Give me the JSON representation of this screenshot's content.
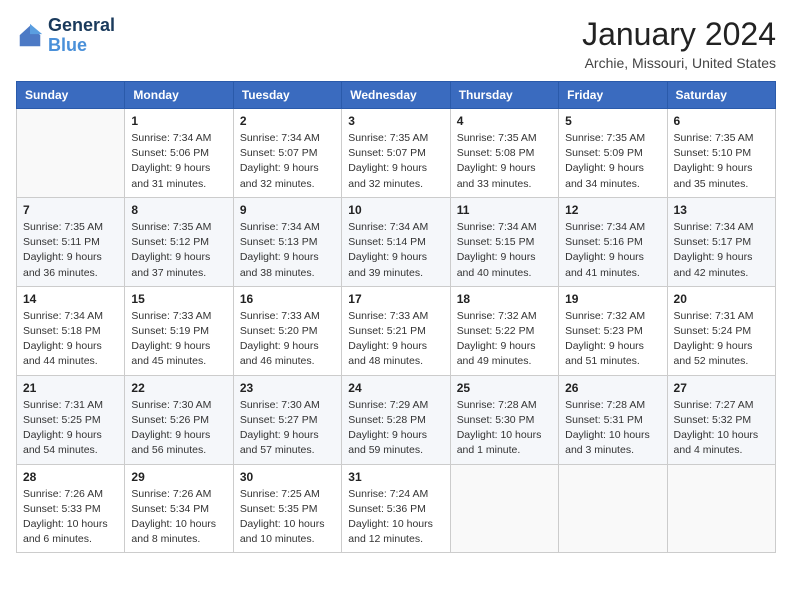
{
  "header": {
    "logo_line1": "General",
    "logo_line2": "Blue",
    "month_title": "January 2024",
    "location": "Archie, Missouri, United States"
  },
  "weekdays": [
    "Sunday",
    "Monday",
    "Tuesday",
    "Wednesday",
    "Thursday",
    "Friday",
    "Saturday"
  ],
  "weeks": [
    [
      {
        "day": "",
        "sunrise": "",
        "sunset": "",
        "daylight": ""
      },
      {
        "day": "1",
        "sunrise": "Sunrise: 7:34 AM",
        "sunset": "Sunset: 5:06 PM",
        "daylight": "Daylight: 9 hours and 31 minutes."
      },
      {
        "day": "2",
        "sunrise": "Sunrise: 7:34 AM",
        "sunset": "Sunset: 5:07 PM",
        "daylight": "Daylight: 9 hours and 32 minutes."
      },
      {
        "day": "3",
        "sunrise": "Sunrise: 7:35 AM",
        "sunset": "Sunset: 5:07 PM",
        "daylight": "Daylight: 9 hours and 32 minutes."
      },
      {
        "day": "4",
        "sunrise": "Sunrise: 7:35 AM",
        "sunset": "Sunset: 5:08 PM",
        "daylight": "Daylight: 9 hours and 33 minutes."
      },
      {
        "day": "5",
        "sunrise": "Sunrise: 7:35 AM",
        "sunset": "Sunset: 5:09 PM",
        "daylight": "Daylight: 9 hours and 34 minutes."
      },
      {
        "day": "6",
        "sunrise": "Sunrise: 7:35 AM",
        "sunset": "Sunset: 5:10 PM",
        "daylight": "Daylight: 9 hours and 35 minutes."
      }
    ],
    [
      {
        "day": "7",
        "sunrise": "Sunrise: 7:35 AM",
        "sunset": "Sunset: 5:11 PM",
        "daylight": "Daylight: 9 hours and 36 minutes."
      },
      {
        "day": "8",
        "sunrise": "Sunrise: 7:35 AM",
        "sunset": "Sunset: 5:12 PM",
        "daylight": "Daylight: 9 hours and 37 minutes."
      },
      {
        "day": "9",
        "sunrise": "Sunrise: 7:34 AM",
        "sunset": "Sunset: 5:13 PM",
        "daylight": "Daylight: 9 hours and 38 minutes."
      },
      {
        "day": "10",
        "sunrise": "Sunrise: 7:34 AM",
        "sunset": "Sunset: 5:14 PM",
        "daylight": "Daylight: 9 hours and 39 minutes."
      },
      {
        "day": "11",
        "sunrise": "Sunrise: 7:34 AM",
        "sunset": "Sunset: 5:15 PM",
        "daylight": "Daylight: 9 hours and 40 minutes."
      },
      {
        "day": "12",
        "sunrise": "Sunrise: 7:34 AM",
        "sunset": "Sunset: 5:16 PM",
        "daylight": "Daylight: 9 hours and 41 minutes."
      },
      {
        "day": "13",
        "sunrise": "Sunrise: 7:34 AM",
        "sunset": "Sunset: 5:17 PM",
        "daylight": "Daylight: 9 hours and 42 minutes."
      }
    ],
    [
      {
        "day": "14",
        "sunrise": "Sunrise: 7:34 AM",
        "sunset": "Sunset: 5:18 PM",
        "daylight": "Daylight: 9 hours and 44 minutes."
      },
      {
        "day": "15",
        "sunrise": "Sunrise: 7:33 AM",
        "sunset": "Sunset: 5:19 PM",
        "daylight": "Daylight: 9 hours and 45 minutes."
      },
      {
        "day": "16",
        "sunrise": "Sunrise: 7:33 AM",
        "sunset": "Sunset: 5:20 PM",
        "daylight": "Daylight: 9 hours and 46 minutes."
      },
      {
        "day": "17",
        "sunrise": "Sunrise: 7:33 AM",
        "sunset": "Sunset: 5:21 PM",
        "daylight": "Daylight: 9 hours and 48 minutes."
      },
      {
        "day": "18",
        "sunrise": "Sunrise: 7:32 AM",
        "sunset": "Sunset: 5:22 PM",
        "daylight": "Daylight: 9 hours and 49 minutes."
      },
      {
        "day": "19",
        "sunrise": "Sunrise: 7:32 AM",
        "sunset": "Sunset: 5:23 PM",
        "daylight": "Daylight: 9 hours and 51 minutes."
      },
      {
        "day": "20",
        "sunrise": "Sunrise: 7:31 AM",
        "sunset": "Sunset: 5:24 PM",
        "daylight": "Daylight: 9 hours and 52 minutes."
      }
    ],
    [
      {
        "day": "21",
        "sunrise": "Sunrise: 7:31 AM",
        "sunset": "Sunset: 5:25 PM",
        "daylight": "Daylight: 9 hours and 54 minutes."
      },
      {
        "day": "22",
        "sunrise": "Sunrise: 7:30 AM",
        "sunset": "Sunset: 5:26 PM",
        "daylight": "Daylight: 9 hours and 56 minutes."
      },
      {
        "day": "23",
        "sunrise": "Sunrise: 7:30 AM",
        "sunset": "Sunset: 5:27 PM",
        "daylight": "Daylight: 9 hours and 57 minutes."
      },
      {
        "day": "24",
        "sunrise": "Sunrise: 7:29 AM",
        "sunset": "Sunset: 5:28 PM",
        "daylight": "Daylight: 9 hours and 59 minutes."
      },
      {
        "day": "25",
        "sunrise": "Sunrise: 7:28 AM",
        "sunset": "Sunset: 5:30 PM",
        "daylight": "Daylight: 10 hours and 1 minute."
      },
      {
        "day": "26",
        "sunrise": "Sunrise: 7:28 AM",
        "sunset": "Sunset: 5:31 PM",
        "daylight": "Daylight: 10 hours and 3 minutes."
      },
      {
        "day": "27",
        "sunrise": "Sunrise: 7:27 AM",
        "sunset": "Sunset: 5:32 PM",
        "daylight": "Daylight: 10 hours and 4 minutes."
      }
    ],
    [
      {
        "day": "28",
        "sunrise": "Sunrise: 7:26 AM",
        "sunset": "Sunset: 5:33 PM",
        "daylight": "Daylight: 10 hours and 6 minutes."
      },
      {
        "day": "29",
        "sunrise": "Sunrise: 7:26 AM",
        "sunset": "Sunset: 5:34 PM",
        "daylight": "Daylight: 10 hours and 8 minutes."
      },
      {
        "day": "30",
        "sunrise": "Sunrise: 7:25 AM",
        "sunset": "Sunset: 5:35 PM",
        "daylight": "Daylight: 10 hours and 10 minutes."
      },
      {
        "day": "31",
        "sunrise": "Sunrise: 7:24 AM",
        "sunset": "Sunset: 5:36 PM",
        "daylight": "Daylight: 10 hours and 12 minutes."
      },
      {
        "day": "",
        "sunrise": "",
        "sunset": "",
        "daylight": ""
      },
      {
        "day": "",
        "sunrise": "",
        "sunset": "",
        "daylight": ""
      },
      {
        "day": "",
        "sunrise": "",
        "sunset": "",
        "daylight": ""
      }
    ]
  ]
}
